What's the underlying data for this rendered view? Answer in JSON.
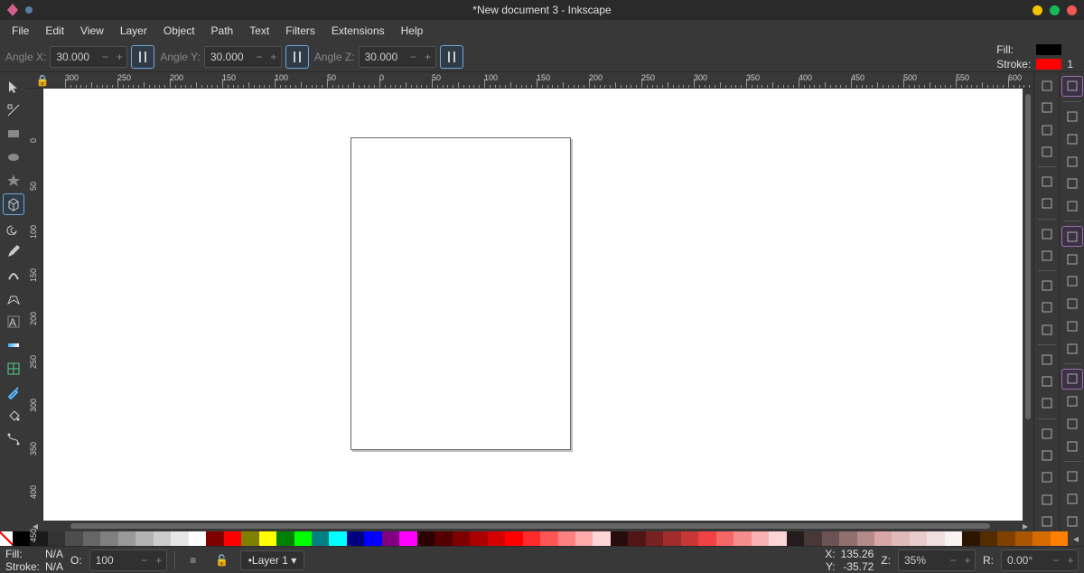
{
  "title": "*New document 3 - Inkscape",
  "menu": [
    "File",
    "Edit",
    "View",
    "Layer",
    "Object",
    "Path",
    "Text",
    "Filters",
    "Extensions",
    "Help"
  ],
  "toolopts": {
    "angleX_label": "Angle X:",
    "angleX": "30.000",
    "angleY_label": "Angle Y:",
    "angleY": "30.000",
    "angleZ_label": "Angle Z:",
    "angleZ": "30.000"
  },
  "fillstroke": {
    "fill_label": "Fill:",
    "stroke_label": "Stroke:",
    "fill_color": "#000000",
    "stroke_color": "#ff0000",
    "stroke_width": "1"
  },
  "left_tools": [
    {
      "name": "selector-tool",
      "svg": "arrow"
    },
    {
      "name": "node-tool",
      "svg": "node"
    },
    {
      "name": "rectangle-tool",
      "svg": "rect"
    },
    {
      "name": "circle-tool",
      "svg": "ellipse"
    },
    {
      "name": "star-tool",
      "svg": "star"
    },
    {
      "name": "3dbox-tool",
      "svg": "box3d",
      "sel": true
    },
    {
      "name": "spiral-tool",
      "svg": "spiral"
    },
    {
      "name": "pencil-tool",
      "svg": "pencil"
    },
    {
      "name": "calligraphy-tool",
      "svg": "callig"
    },
    {
      "name": "pen-tool",
      "svg": "pen"
    },
    {
      "name": "text-tool",
      "svg": "text"
    },
    {
      "name": "gradient-tool",
      "svg": "gradient"
    },
    {
      "name": "mesh-tool",
      "svg": "mesh"
    },
    {
      "name": "dropper-tool",
      "svg": "dropper"
    },
    {
      "name": "paintbucket-tool",
      "svg": "bucket"
    },
    {
      "name": "connector-tool",
      "svg": "connector"
    }
  ],
  "rcol1": [
    {
      "name": "new-doc-icon",
      "svg": "newdoc"
    },
    {
      "name": "open-icon",
      "svg": "open"
    },
    {
      "name": "save-icon",
      "svg": "save"
    },
    {
      "name": "print-icon",
      "svg": "print"
    },
    {
      "name": "import-icon",
      "svg": "import"
    },
    {
      "name": "export-icon",
      "svg": "export"
    },
    {
      "name": "undo-icon",
      "svg": "undo"
    },
    {
      "name": "redo-icon",
      "svg": "redo"
    },
    {
      "name": "copy-icon",
      "svg": "copy"
    },
    {
      "name": "cut-icon",
      "svg": "cut"
    },
    {
      "name": "paste-icon",
      "svg": "paste"
    },
    {
      "name": "zoom-sel-icon",
      "svg": "zoomsel"
    },
    {
      "name": "zoom-draw-icon",
      "svg": "zoomdraw"
    },
    {
      "name": "zoom-page-icon",
      "svg": "zoompage"
    },
    {
      "name": "duplicate-icon",
      "svg": "dup"
    },
    {
      "name": "clone-icon",
      "svg": "clone"
    },
    {
      "name": "unlink-icon",
      "svg": "unlink"
    },
    {
      "name": "group-icon",
      "svg": "group"
    },
    {
      "name": "prefs-icon",
      "svg": "prefs"
    }
  ],
  "rcol2": [
    {
      "name": "snap-enable-icon",
      "svg": "snap",
      "sel": true
    },
    {
      "name": "snap-bbox-icon",
      "svg": "snap2"
    },
    {
      "name": "snap-edge-icon",
      "svg": "snap3"
    },
    {
      "name": "snap-corner-icon",
      "svg": "snap4"
    },
    {
      "name": "snap-mid-icon",
      "svg": "snap5"
    },
    {
      "name": "snap-center-icon",
      "svg": "snap6"
    },
    {
      "name": "snap-node-icon",
      "svg": "snap7",
      "sel": true
    },
    {
      "name": "snap-path-icon",
      "svg": "snap8"
    },
    {
      "name": "snap-int-icon",
      "svg": "snap9"
    },
    {
      "name": "snap-cusp-icon",
      "svg": "snap10"
    },
    {
      "name": "snap-smooth-icon",
      "svg": "snap11"
    },
    {
      "name": "snap-line-icon",
      "svg": "snap12"
    },
    {
      "name": "snap-other-icon",
      "svg": "snap13",
      "sel": true
    },
    {
      "name": "snap-obj-icon",
      "svg": "snap14"
    },
    {
      "name": "snap-rot-icon",
      "svg": "snap15"
    },
    {
      "name": "snap-text-icon",
      "svg": "snap16"
    },
    {
      "name": "snap-page-icon",
      "svg": "snap17"
    },
    {
      "name": "snap-grid-icon",
      "svg": "snap18"
    },
    {
      "name": "snap-guide-icon",
      "svg": "snap19"
    }
  ],
  "ruler_h": [
    -300,
    -250,
    -200,
    -150,
    -100,
    -50,
    0,
    50,
    100,
    150,
    200,
    250,
    300,
    350,
    400,
    450,
    500,
    550,
    600
  ],
  "ruler_v": [
    0,
    50,
    100,
    150,
    200,
    250,
    300,
    350,
    400,
    450
  ],
  "palette": [
    "#000000",
    "#1a1a1a",
    "#333333",
    "#4d4d4d",
    "#666666",
    "#808080",
    "#999999",
    "#b3b3b3",
    "#cccccc",
    "#e6e6e6",
    "#ffffff",
    "#800000",
    "#ff0000",
    "#808000",
    "#ffff00",
    "#008000",
    "#00ff00",
    "#008080",
    "#00ffff",
    "#000080",
    "#0000ff",
    "#800080",
    "#ff00ff",
    "#2c0000",
    "#550000",
    "#800000",
    "#aa0000",
    "#d40000",
    "#ff0000",
    "#ff2a2a",
    "#ff5555",
    "#ff8080",
    "#ffaaaa",
    "#ffd5d5",
    "#280b0b",
    "#501616",
    "#782121",
    "#a02c2c",
    "#c83737",
    "#f04242",
    "#f36767",
    "#f68c8c",
    "#f9b1b1",
    "#fcd6d6",
    "#241c1c",
    "#483737",
    "#6c5353",
    "#906f6f",
    "#b48a8a",
    "#d8a6a6",
    "#e0b9b9",
    "#e8cccc",
    "#f0dfdf",
    "#f8f2f2",
    "#2c1600",
    "#552b00",
    "#804000",
    "#aa5500",
    "#d46a00",
    "#ff7f00"
  ],
  "status": {
    "fill_label": "Fill:",
    "fill_value": "N/A",
    "stroke_label": "Stroke:",
    "stroke_value": "N/A",
    "opacity_label": "O:",
    "opacity": "100",
    "layer": "•Layer 1 ▾",
    "x_label": "X:",
    "x": "135.26",
    "y_label": "Y:",
    "y": "-35.72",
    "z_label": "Z:",
    "z": "35%",
    "r_label": "R:",
    "r": "0.00°"
  }
}
